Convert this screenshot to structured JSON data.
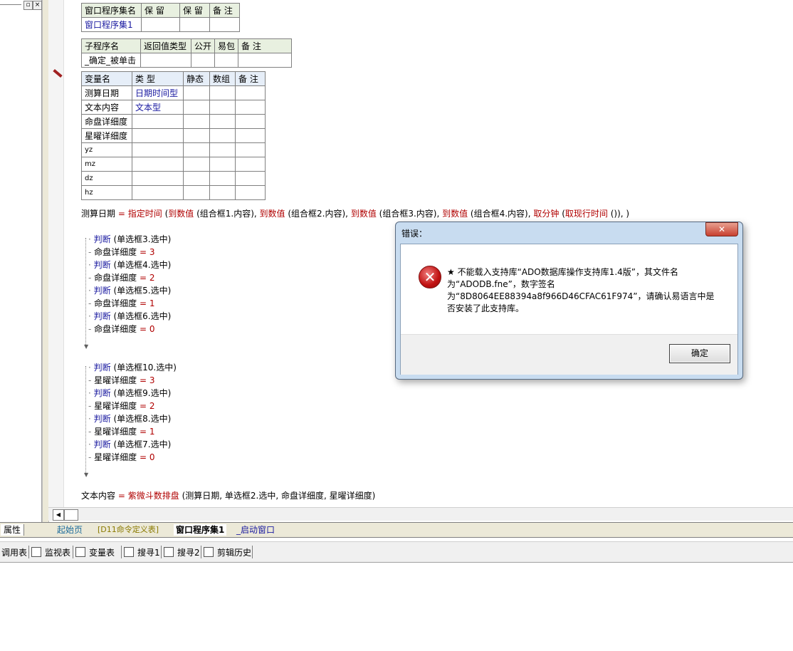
{
  "window_table": {
    "headers": [
      "窗口程序集名",
      "保 留",
      "保 留",
      "备 注"
    ],
    "row": [
      "窗口程序集1",
      "",
      "",
      ""
    ]
  },
  "sub_table": {
    "headers": [
      "子程序名",
      "返回值类型",
      "公开",
      "易包",
      "备 注"
    ],
    "row": [
      "_确定_被单击",
      "",
      "",
      "",
      ""
    ]
  },
  "var_table": {
    "headers": [
      "变量名",
      "类 型",
      "静态",
      "数组",
      "备 注"
    ],
    "rows": [
      [
        "测算日期",
        "日期时间型"
      ],
      [
        "文本内容",
        "文本型"
      ],
      [
        "命盘详细度",
        ""
      ],
      [
        "星曜详细度",
        ""
      ],
      [
        "yz",
        ""
      ],
      [
        "mz",
        ""
      ],
      [
        "dz",
        ""
      ],
      [
        "hz",
        ""
      ]
    ]
  },
  "code": {
    "line1": {
      "target": "测算日期",
      "eq": "=",
      "fn": "指定时间",
      "rest_parts": [
        {
          "t": " (",
          "c": ""
        },
        {
          "t": "到数值",
          "c": "kw"
        },
        {
          "t": " (组合框1.内容), ",
          "c": ""
        },
        {
          "t": "到数值",
          "c": "kw"
        },
        {
          "t": " (组合框2.内容), ",
          "c": ""
        },
        {
          "t": "到数值",
          "c": "kw"
        },
        {
          "t": " (组合框3.内容), ",
          "c": ""
        },
        {
          "t": "到数值",
          "c": "kw"
        },
        {
          "t": " (组合框4.内容), ",
          "c": ""
        },
        {
          "t": "取分钟",
          "c": "kw"
        },
        {
          "t": " (",
          "c": ""
        },
        {
          "t": "取现行时间",
          "c": "kw"
        },
        {
          "t": " ()), )",
          "c": ""
        }
      ]
    },
    "block1": [
      {
        "kind": "if",
        "kw": "判断",
        "arg": " (单选框3.选中)"
      },
      {
        "kind": "assign",
        "lhs": "命盘详细度",
        "eq": "=",
        "val": "3"
      },
      {
        "kind": "if",
        "kw": "判断",
        "arg": " (单选框4.选中)"
      },
      {
        "kind": "assign",
        "lhs": "命盘详细度",
        "eq": "=",
        "val": "2"
      },
      {
        "kind": "if",
        "kw": "判断",
        "arg": " (单选框5.选中)"
      },
      {
        "kind": "assign",
        "lhs": "命盘详细度",
        "eq": "=",
        "val": "1"
      },
      {
        "kind": "if",
        "kw": "判断",
        "arg": " (单选框6.选中)"
      },
      {
        "kind": "assign",
        "lhs": "命盘详细度",
        "eq": "=",
        "val": "0"
      }
    ],
    "block2": [
      {
        "kind": "if",
        "kw": "判断",
        "arg": " (单选框10.选中)"
      },
      {
        "kind": "assign",
        "lhs": "星曜详细度",
        "eq": "=",
        "val": "3"
      },
      {
        "kind": "if",
        "kw": "判断",
        "arg": " (单选框9.选中)"
      },
      {
        "kind": "assign",
        "lhs": "星曜详细度",
        "eq": "=",
        "val": "2"
      },
      {
        "kind": "if",
        "kw": "判断",
        "arg": " (单选框8.选中)"
      },
      {
        "kind": "assign",
        "lhs": "星曜详细度",
        "eq": "=",
        "val": "1"
      },
      {
        "kind": "if",
        "kw": "判断",
        "arg": " (单选框7.选中)"
      },
      {
        "kind": "assign",
        "lhs": "星曜详细度",
        "eq": "=",
        "val": "0"
      }
    ],
    "last": {
      "target": "文本内容",
      "eq": "=",
      "fn": "紫微斗数排盘",
      "args": " (测算日期, 单选框2.选中, 命盘详细度, 星曜详细度)"
    }
  },
  "dialog": {
    "title": "错误：",
    "close": "✕",
    "icon": "error-icon",
    "message": "★ 不能载入支持库“ADO数据库操作支持库1.4版”，其文件名为“ADODB.fne”，数字签名为“8D8064EE88394a8f966D46CFAC61F974”，请确认易语言中是否安装了此支持库。",
    "ok": "确定"
  },
  "tabs": {
    "left_label": "属性",
    "items": [
      "起始页",
      "[D11命令定义表]",
      "窗口程序集1",
      "_启动窗口"
    ]
  },
  "toolbar": {
    "items": [
      {
        "label": "调用表",
        "icon": "call-table-icon"
      },
      {
        "label": "监视表",
        "icon": "magnifier-icon"
      },
      {
        "label": "变量表",
        "icon": "variables-icon"
      },
      {
        "label": "搜寻1",
        "icon": "search-icon"
      },
      {
        "label": "搜寻2",
        "icon": "search-icon"
      },
      {
        "label": "剪辑历史",
        "icon": "clipboard-icon"
      }
    ]
  },
  "colors": {
    "keyword": "#b00000",
    "function": "#1a1aa0",
    "dialog_frame": "#c8dcf0"
  }
}
